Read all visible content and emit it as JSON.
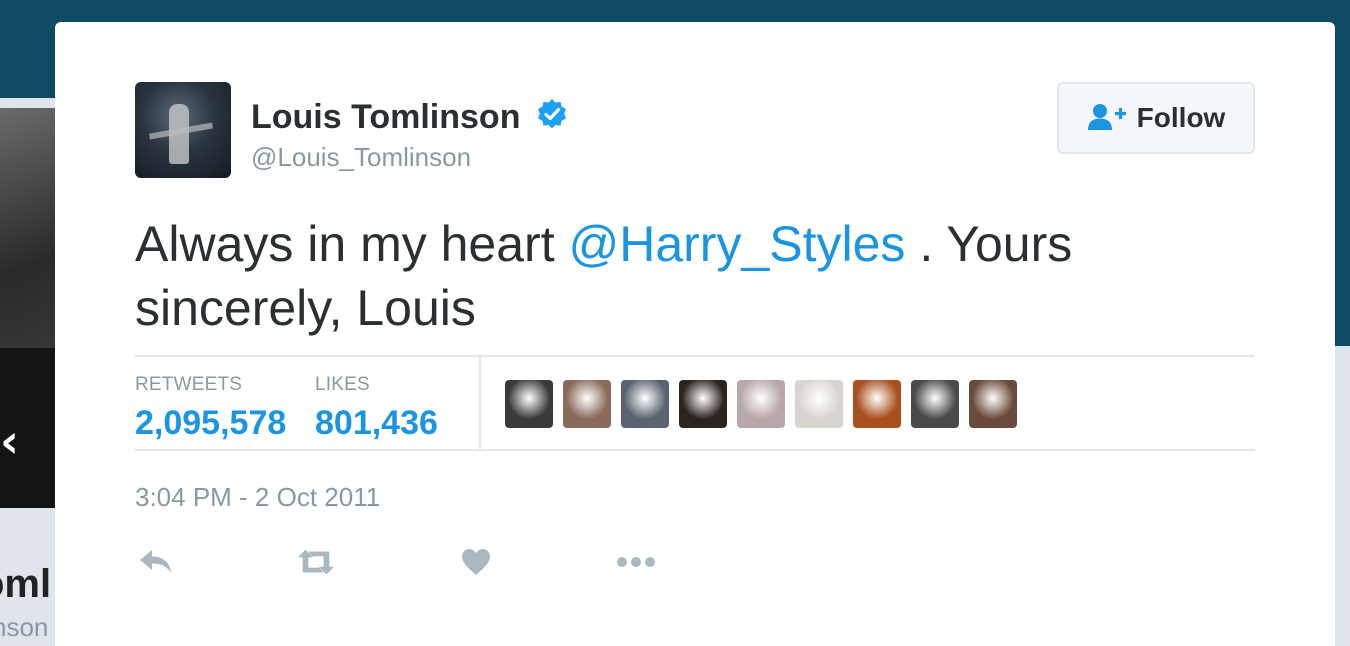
{
  "background": {
    "profile_name_partial": "oml",
    "profile_handle_partial": "nson",
    "chevron_glyph": "‹",
    "header_color": "#0f4a63"
  },
  "tweet": {
    "author": {
      "display_name": "Louis Tomlinson",
      "handle": "@Louis_Tomlinson",
      "verified": true,
      "avatar_icon": "profile-photo"
    },
    "follow_button": {
      "label": "Follow",
      "icon": "add-user-icon"
    },
    "text_before": "Always in my heart ",
    "mention": "@Harry_Styles",
    "text_after": " . Yours sincerely, Louis",
    "stats": {
      "retweets_label": "RETWEETS",
      "retweets_value": "2,095,578",
      "likes_label": "LIKES",
      "likes_value": "801,436"
    },
    "likers": [
      {
        "icon": "liker-avatar",
        "color": "#3a3a3a"
      },
      {
        "icon": "liker-avatar",
        "color": "#8a6a5a"
      },
      {
        "icon": "liker-avatar",
        "color": "#5a6470"
      },
      {
        "icon": "liker-avatar",
        "color": "#2c2420"
      },
      {
        "icon": "liker-avatar",
        "color": "#b8a6a8"
      },
      {
        "icon": "liker-avatar",
        "color": "#d8d4d0"
      },
      {
        "icon": "liker-avatar",
        "color": "#a8501e"
      },
      {
        "icon": "liker-avatar",
        "color": "#4a4a4a"
      },
      {
        "icon": "liker-avatar",
        "color": "#6a4a3a"
      }
    ],
    "timestamp": "3:04 PM - 2 Oct 2011",
    "actions": [
      "reply-icon",
      "retweet-icon",
      "like-icon",
      "more-icon"
    ]
  },
  "colors": {
    "accent": "#1b95e0",
    "muted": "#8899a6",
    "text": "#292f33"
  }
}
